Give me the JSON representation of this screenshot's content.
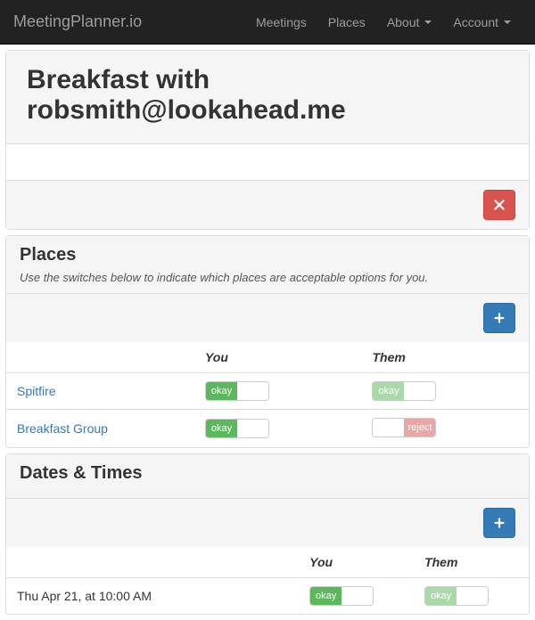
{
  "nav": {
    "brand": "MeetingPlanner.io",
    "items": [
      "Meetings",
      "Places",
      "About",
      "Account"
    ]
  },
  "meeting": {
    "title": "Breakfast with robsmith@lookahead.me"
  },
  "places": {
    "title": "Places",
    "hint": "Use the switches below to indicate which places are acceptable options for you.",
    "columns": {
      "you": "You",
      "them": "Them"
    },
    "rows": [
      {
        "name": "Spitfire",
        "you": {
          "state": "okay",
          "enabled": true
        },
        "them": {
          "state": "okay",
          "enabled": false
        }
      },
      {
        "name": "Breakfast Group",
        "you": {
          "state": "okay",
          "enabled": true
        },
        "them": {
          "state": "reject",
          "enabled": false
        }
      }
    ]
  },
  "dates": {
    "title": "Dates & Times",
    "columns": {
      "you": "You",
      "them": "Them"
    },
    "rows": [
      {
        "name": "Thu Apr 21, at 10:00 AM",
        "you": {
          "state": "okay",
          "enabled": true
        },
        "them": {
          "state": "okay",
          "enabled": false
        }
      }
    ]
  },
  "labels": {
    "okay": "okay",
    "reject": "reject"
  }
}
